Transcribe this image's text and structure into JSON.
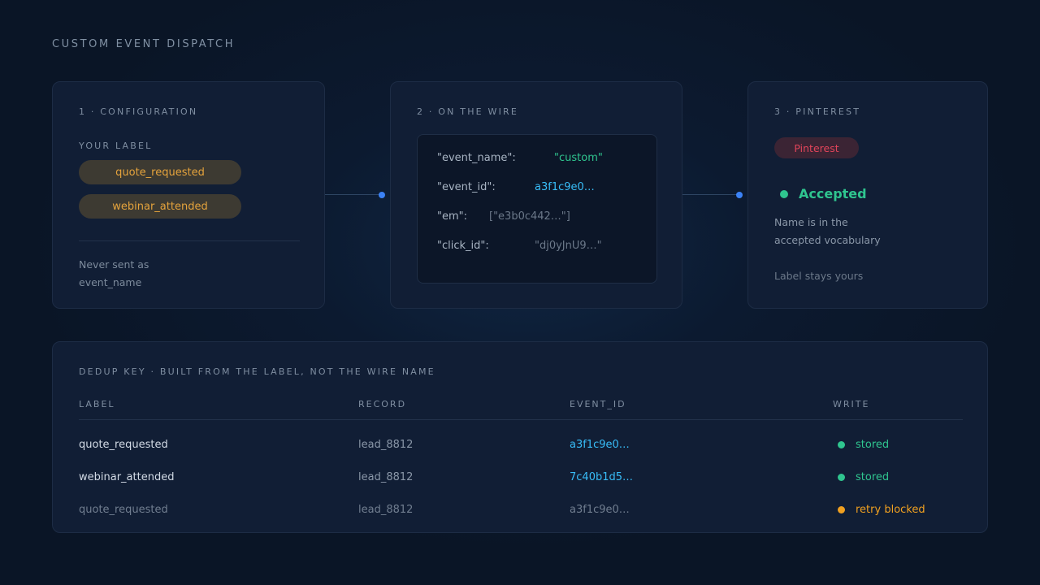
{
  "page_title": "CUSTOM EVENT DISPATCH",
  "configuration": {
    "heading": "1 · CONFIGURATION",
    "your_label_heading": "YOUR LABEL",
    "labels": [
      "quote_requested",
      "webinar_attended"
    ],
    "note_line1": "Never sent as",
    "note_line2": "event_name"
  },
  "wire": {
    "heading": "2 · ON THE WIRE",
    "fields": [
      {
        "key": "\"event_name\":",
        "value": "\"custom\""
      },
      {
        "key": "\"event_id\":",
        "value": "a3f1c9e0…"
      },
      {
        "key": "\"em\":",
        "value": "[\"e3b0c442…\"]"
      },
      {
        "key": "\"click_id\":",
        "value": "\"dj0yJnU9…\""
      }
    ]
  },
  "pinterest": {
    "heading": "3 · PINTEREST",
    "badge": "Pinterest",
    "status": "Accepted",
    "desc_line1": "Name is in the",
    "desc_line2": "accepted vocabulary",
    "footnote": "Label stays yours"
  },
  "dedup": {
    "heading": "DEDUP KEY · BUILT FROM THE LABEL, NOT THE WIRE NAME",
    "columns": [
      "LABEL",
      "RECORD",
      "EVENT_ID",
      "WRITE"
    ],
    "rows": [
      {
        "label": "quote_requested",
        "record": "lead_8812",
        "event_id": "a3f1c9e0…",
        "write": "stored"
      },
      {
        "label": "webinar_attended",
        "record": "lead_8812",
        "event_id": "7c40b1d5…",
        "write": "stored"
      },
      {
        "label": "quote_requested",
        "record": "lead_8812",
        "event_id": "a3f1c9e0…",
        "write": "retry blocked"
      }
    ]
  },
  "colors": {
    "accent_blue": "#3b82f6",
    "label_amber": "#e5a33c",
    "success_green": "#2fc58f",
    "warning_amber": "#f0a020",
    "pinterest_red": "#e0445a",
    "id_cyan": "#38bdf8"
  }
}
